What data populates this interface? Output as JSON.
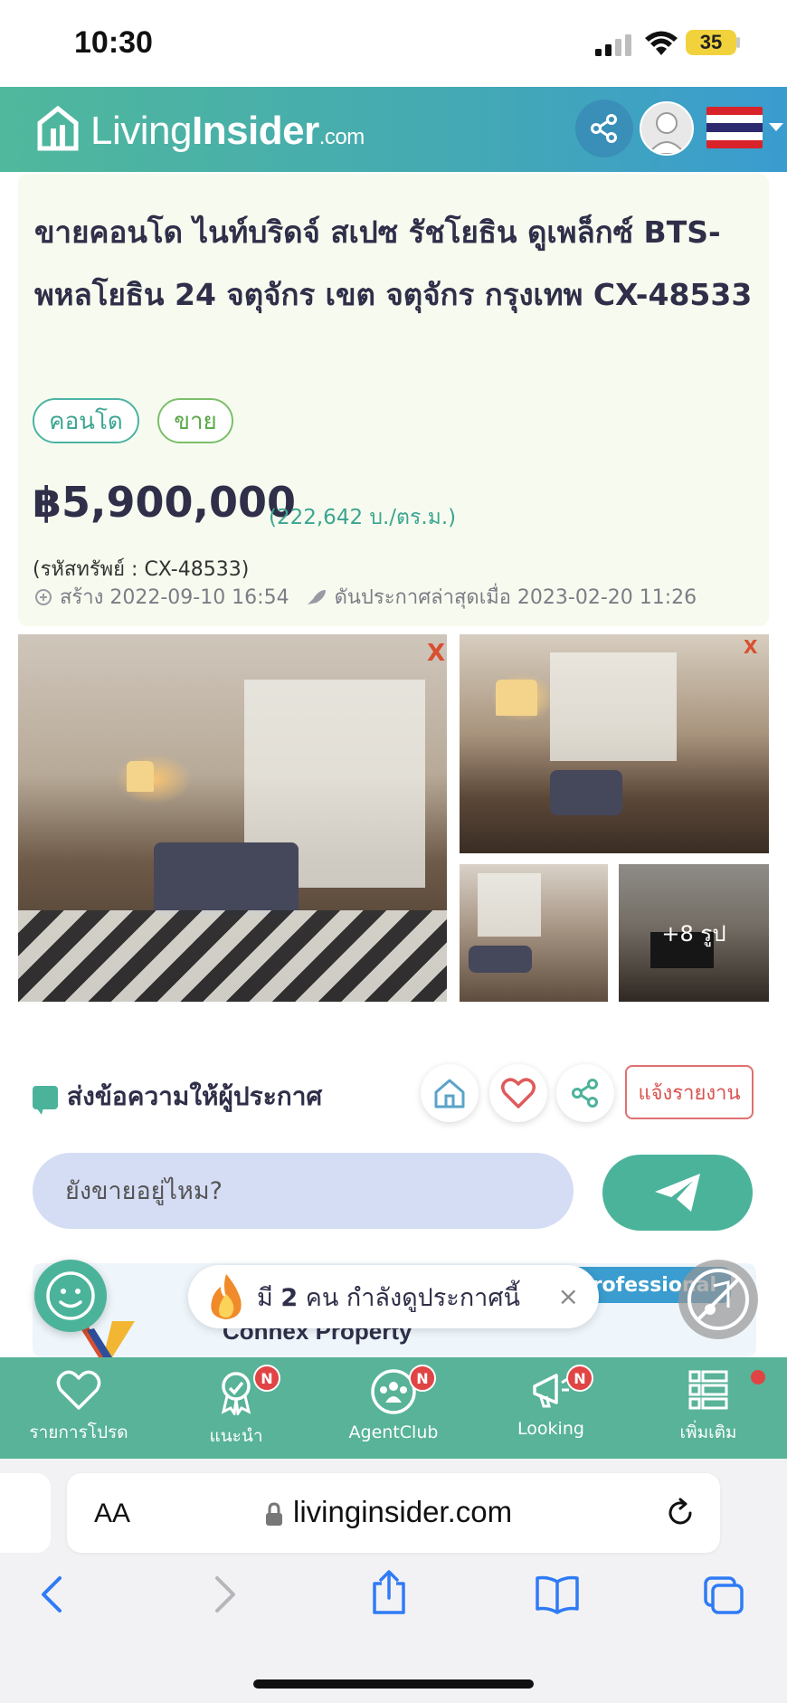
{
  "status_bar": {
    "time": "10:30",
    "battery": "35"
  },
  "header": {
    "logo_living": "Living",
    "logo_insider": "Insider",
    "logo_com": ".com",
    "brand_color": "#50b89c"
  },
  "listing": {
    "title": "ขายคอนโด ไนท์บริดจ์ สเปซ รัชโยธิน ดูเพล็กซ์ BTS-พหลโยธิน 24 จตุจักร เขต จตุจักร กรุงเทพ CX-48533",
    "tags": [
      "คอนโด",
      "ขาย"
    ],
    "price": "฿5,900,000",
    "price_per_sqm": "(222,642 บ./ตร.ม.)",
    "property_code": "(รหัสทรัพย์ : CX-48533)",
    "created": "สร้าง 2022-09-10 16:54",
    "bumped": "ดันประกาศล่าสุดเมื่อ 2023-02-20 11:26",
    "more_photos": "+8 รูป"
  },
  "message": {
    "title": "ส่งข้อความให้ผู้ประกาศ",
    "report": "แจ้งรายงาน",
    "placeholder": "ยังขายอยู่ไหม?"
  },
  "agent": {
    "badge": "Professional",
    "name": "Connex Property"
  },
  "toast": {
    "prefix": "มี",
    "count": "2",
    "suffix": "คน กำลังดูประกาศนี้",
    "close": "×"
  },
  "bottom_nav": {
    "items": [
      {
        "label": "รายการโปรด",
        "icon": "heart-icon",
        "badge": ""
      },
      {
        "label": "แนะนำ",
        "icon": "award-icon",
        "badge": "N"
      },
      {
        "label": "AgentClub",
        "icon": "people-icon",
        "badge": "N"
      },
      {
        "label": "Looking",
        "icon": "megaphone-icon",
        "badge": "N"
      },
      {
        "label": "เพิ่มเติม",
        "icon": "list-icon",
        "badge": ""
      }
    ]
  },
  "browser": {
    "aa": "AA",
    "url": "livinginsider.com"
  }
}
